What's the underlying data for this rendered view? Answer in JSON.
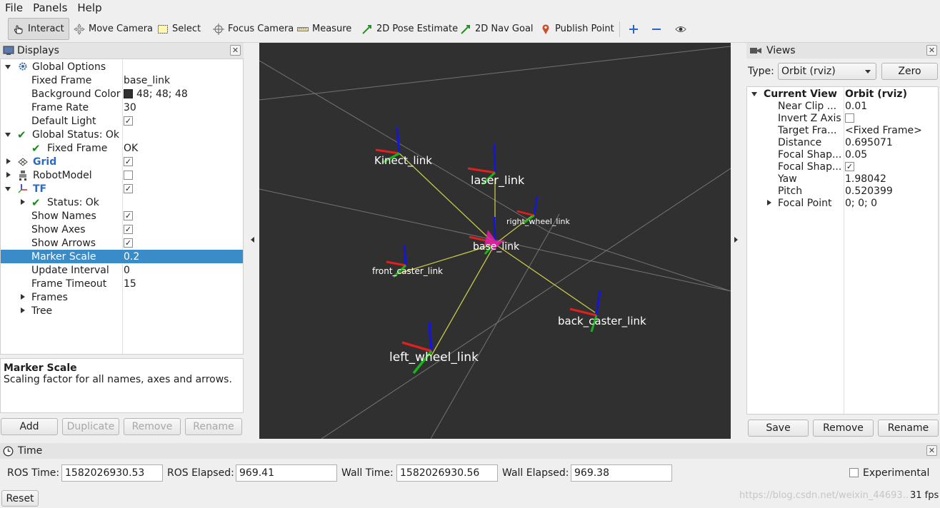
{
  "menu": {
    "file": "File",
    "panels": "Panels",
    "help": "Help"
  },
  "toolbar": {
    "interact": "Interact",
    "move_camera": "Move Camera",
    "select": "Select",
    "focus_camera": "Focus Camera",
    "measure": "Measure",
    "pose_estimate": "2D Pose Estimate",
    "nav_goal": "2D Nav Goal",
    "publish_point": "Publish Point"
  },
  "displays": {
    "title": "Displays",
    "rows": [
      {
        "label": "Global Options",
        "value": ""
      },
      {
        "label": "Fixed Frame",
        "value": "base_link"
      },
      {
        "label": "Background Color",
        "value": "48; 48; 48"
      },
      {
        "label": "Frame Rate",
        "value": "30"
      },
      {
        "label": "Default Light",
        "value": ""
      },
      {
        "label": "Global Status: Ok",
        "value": ""
      },
      {
        "label": "Fixed Frame",
        "value": "OK"
      },
      {
        "label": "Grid",
        "value": ""
      },
      {
        "label": "RobotModel",
        "value": ""
      },
      {
        "label": "TF",
        "value": ""
      },
      {
        "label": "Status: Ok",
        "value": ""
      },
      {
        "label": "Show Names",
        "value": ""
      },
      {
        "label": "Show Axes",
        "value": ""
      },
      {
        "label": "Show Arrows",
        "value": ""
      },
      {
        "label": "Marker Scale",
        "value": "0.2"
      },
      {
        "label": "Update Interval",
        "value": "0"
      },
      {
        "label": "Frame Timeout",
        "value": "15"
      },
      {
        "label": "Frames",
        "value": ""
      },
      {
        "label": "Tree",
        "value": ""
      }
    ],
    "description_title": "Marker Scale",
    "description_text": "Scaling factor for all names, axes and arrows.",
    "buttons": {
      "add": "Add",
      "duplicate": "Duplicate",
      "remove": "Remove",
      "rename": "Rename"
    }
  },
  "viewport": {
    "background_color": "#303030",
    "frames": {
      "kinect": "Kinect_link",
      "laser": "laser_link",
      "right_wheel": "right_wheel_link",
      "base": "base_link",
      "front_caster": "front_caster_link",
      "back_caster": "back_caster_link",
      "left_wheel": "left_wheel_link"
    }
  },
  "views": {
    "title": "Views",
    "type_label": "Type:",
    "type_value": "Orbit (rviz)",
    "zero": "Zero",
    "header_name": "Current View",
    "header_value": "Orbit (rviz)",
    "rows": [
      {
        "label": "Near Clip ...",
        "value": "0.01"
      },
      {
        "label": "Invert Z Axis",
        "value": ""
      },
      {
        "label": "Target Fra...",
        "value": "<Fixed Frame>"
      },
      {
        "label": "Distance",
        "value": "0.695071"
      },
      {
        "label": "Focal Shap...",
        "value": "0.05"
      },
      {
        "label": "Focal Shap...",
        "value": ""
      },
      {
        "label": "Yaw",
        "value": "1.98042"
      },
      {
        "label": "Pitch",
        "value": "0.520399"
      },
      {
        "label": "Focal Point",
        "value": "0; 0; 0"
      }
    ],
    "buttons": {
      "save": "Save",
      "remove": "Remove",
      "rename": "Rename"
    }
  },
  "time": {
    "title": "Time",
    "ros_time_label": "ROS Time:",
    "ros_time": "1582026930.53",
    "ros_elapsed_label": "ROS Elapsed:",
    "ros_elapsed": "969.41",
    "wall_time_label": "Wall Time:",
    "wall_time": "1582026930.56",
    "wall_elapsed_label": "Wall Elapsed:",
    "wall_elapsed": "969.38",
    "experimental": "Experimental",
    "reset": "Reset",
    "fps": "31 fps",
    "watermark": "https://blog.csdn.net/weixin_44693..."
  },
  "colors": {
    "selection": "#3a8cc8",
    "axis_x": "#e0201e",
    "axis_y": "#18b418",
    "axis_z": "#1416d8",
    "link": "#c8c84a",
    "arrow_head": "#e01ea8"
  }
}
